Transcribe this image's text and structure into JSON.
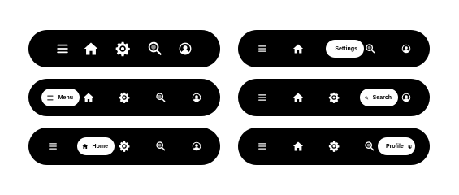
{
  "colors": {
    "bar": "#000000",
    "icon": "#ffffff",
    "pill": "#ffffff",
    "pill_text": "#000000"
  },
  "nav_bars": [
    {
      "active": "none",
      "items": [
        "menu-icon",
        "home-icon",
        "gear-icon",
        "search-icon",
        "profile-icon"
      ]
    },
    {
      "active": "settings",
      "active_label": "Settings"
    },
    {
      "active": "menu",
      "active_label": "Menu"
    },
    {
      "active": "search",
      "active_label": "Search"
    },
    {
      "active": "home",
      "active_label": "Home"
    },
    {
      "active": "profile",
      "active_label": "Profile"
    }
  ]
}
